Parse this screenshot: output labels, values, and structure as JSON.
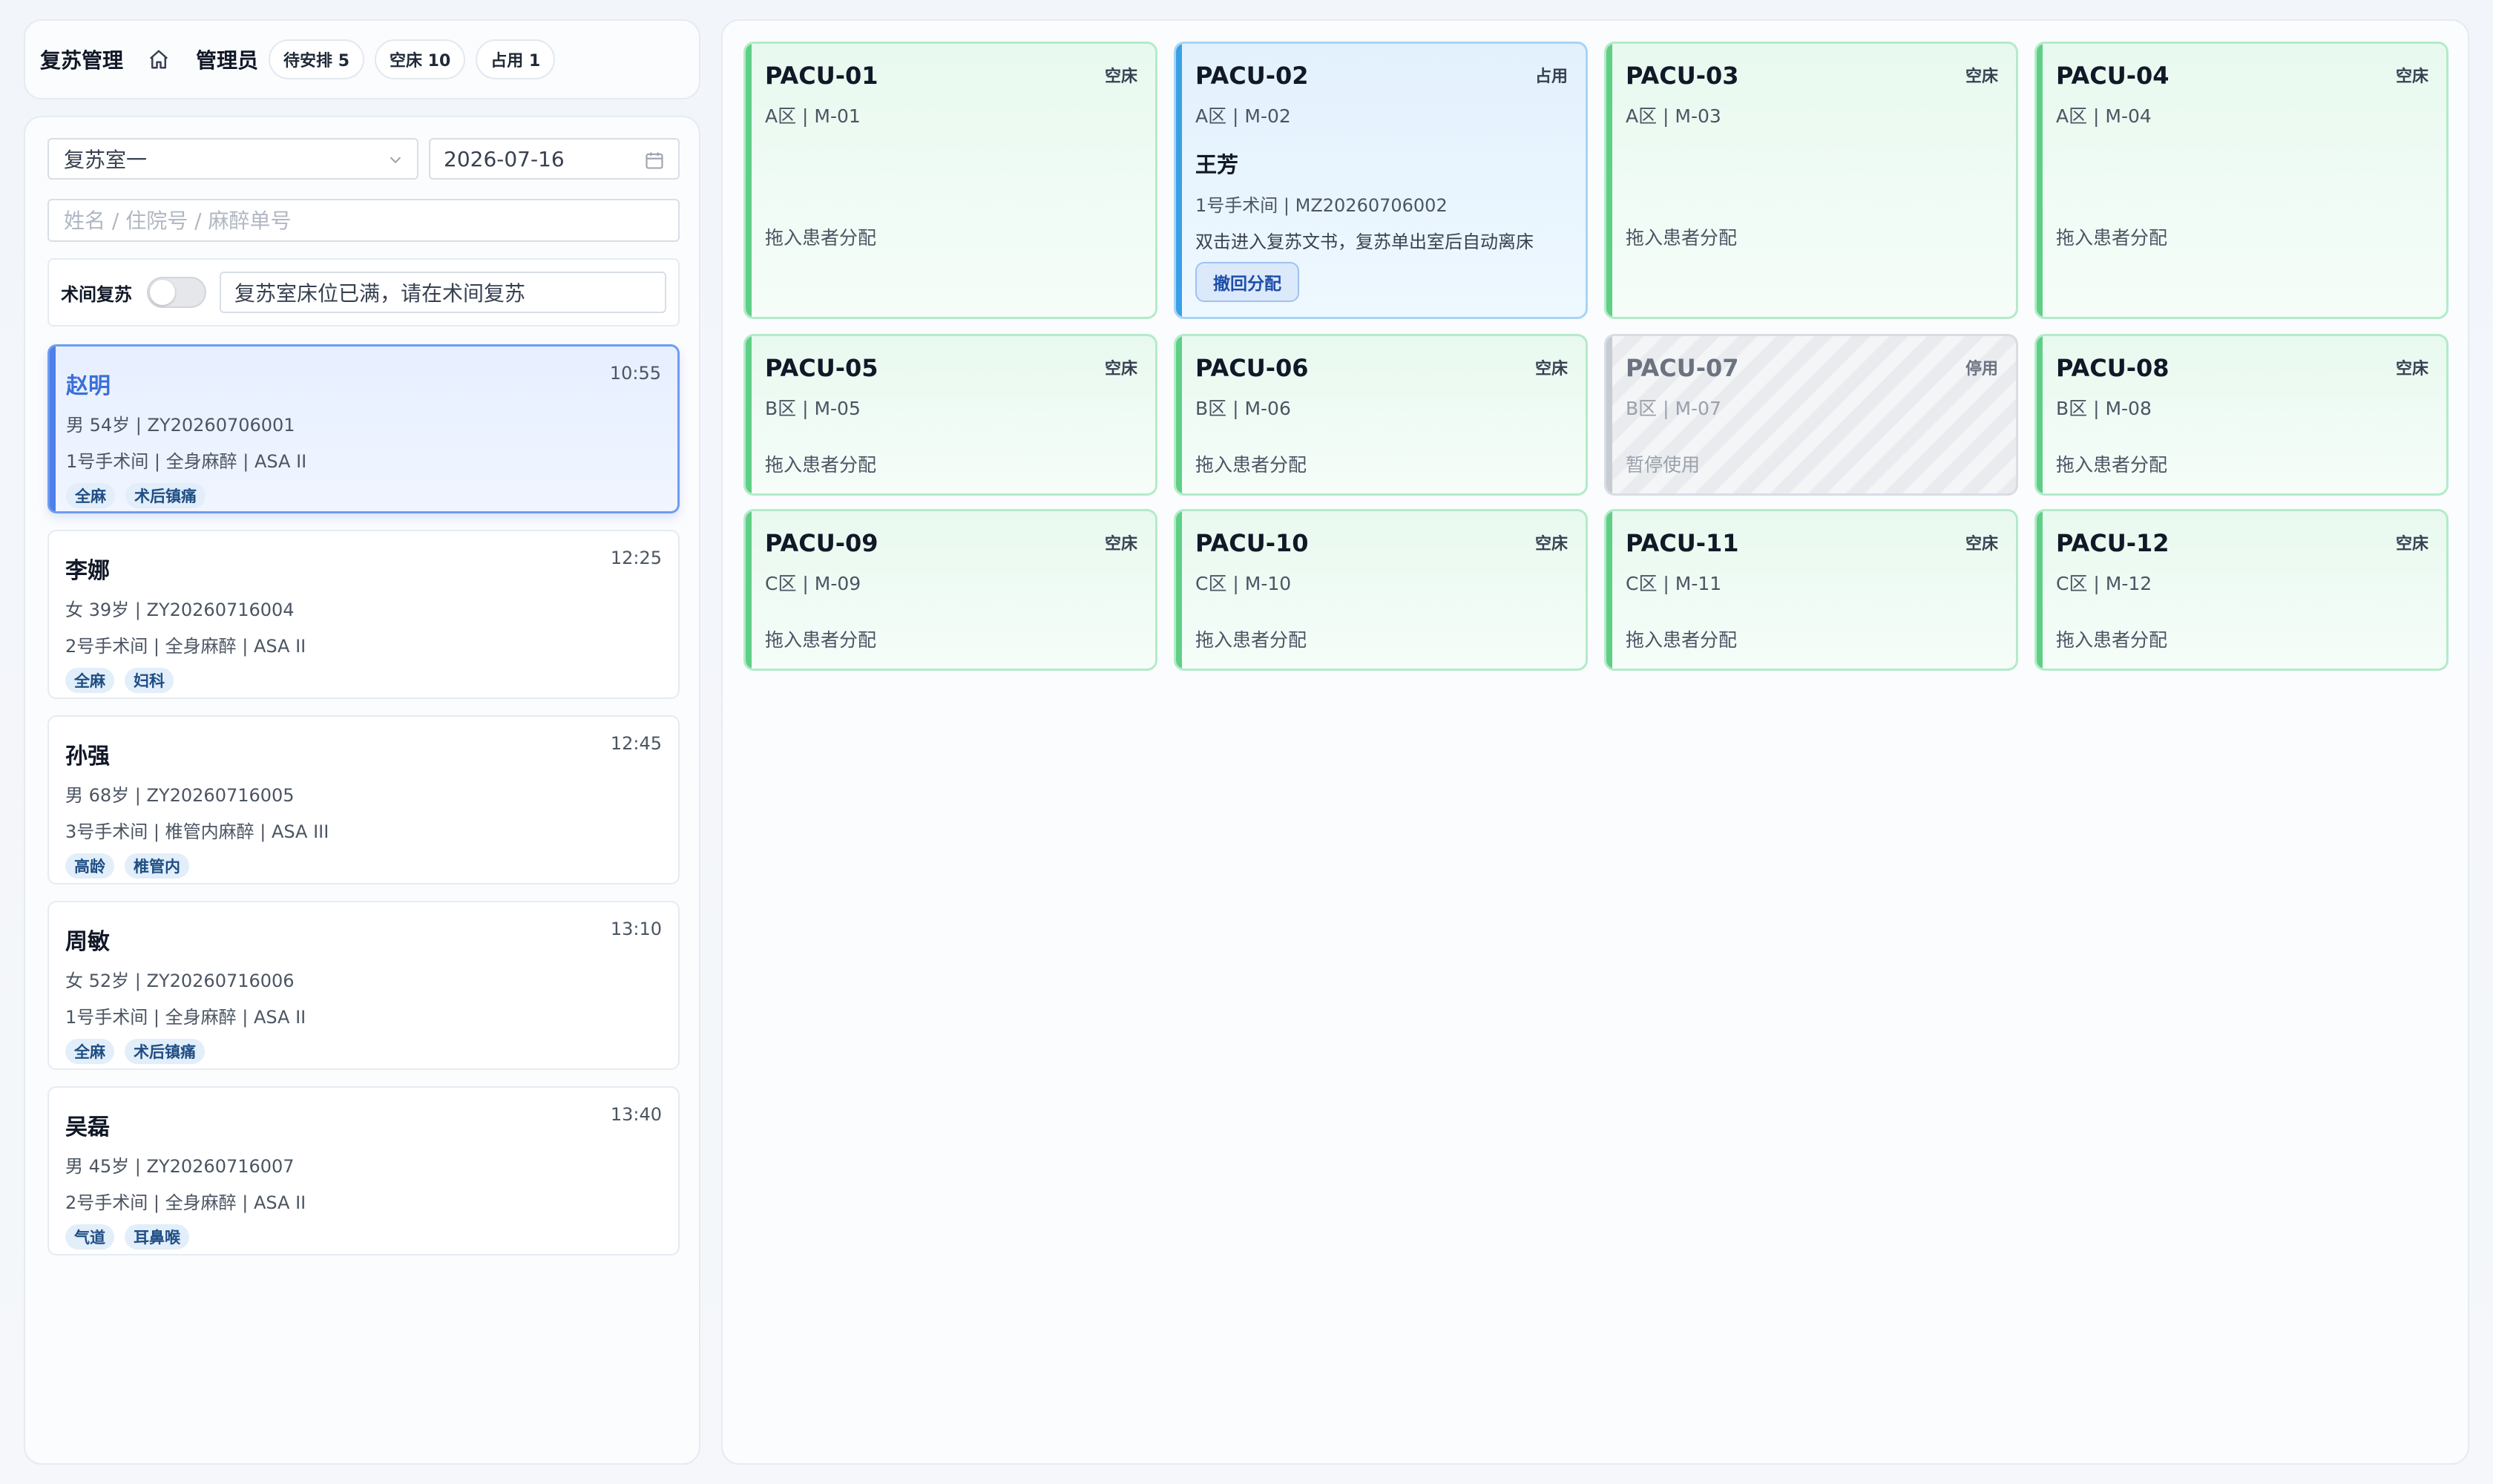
{
  "header": {
    "app_title": "复苏管理",
    "user_name": "管理员",
    "chips": [
      {
        "label": "待安排 5"
      },
      {
        "label": "空床 10"
      },
      {
        "label": "占用 1"
      }
    ]
  },
  "filters": {
    "room_select": "复苏室一",
    "date": "2026-07-16",
    "search_placeholder": "姓名 / 住院号 / 麻醉单号",
    "intraop_label": "术间复苏",
    "intraop_enabled": false,
    "notice": "复苏室床位已满，请在术间复苏"
  },
  "patients": [
    {
      "name": "赵明",
      "time": "10:55",
      "info": "男 54岁 | ZY20260706001",
      "surgery": "1号手术间 | 全身麻醉 | ASA II",
      "tags": [
        "全麻",
        "术后镇痛"
      ],
      "selected": true
    },
    {
      "name": "李娜",
      "time": "12:25",
      "info": "女 39岁 | ZY20260716004",
      "surgery": "2号手术间 | 全身麻醉 | ASA II",
      "tags": [
        "全麻",
        "妇科"
      ]
    },
    {
      "name": "孙强",
      "time": "12:45",
      "info": "男 68岁 | ZY20260716005",
      "surgery": "3号手术间 | 椎管内麻醉 | ASA III",
      "tags": [
        "高龄",
        "椎管内"
      ]
    },
    {
      "name": "周敏",
      "time": "13:10",
      "info": "女 52岁 | ZY20260716006",
      "surgery": "1号手术间 | 全身麻醉 | ASA II",
      "tags": [
        "全麻",
        "术后镇痛"
      ]
    },
    {
      "name": "吴磊",
      "time": "13:40",
      "info": "男 45岁 | ZY20260716007",
      "surgery": "2号手术间 | 全身麻醉 | ASA II",
      "tags": [
        "气道",
        "耳鼻喉"
      ]
    }
  ],
  "beds": [
    {
      "code": "PACU-01",
      "status": "空床",
      "loc": "A区 | M-01",
      "hint": "拖入患者分配"
    },
    {
      "code": "PACU-02",
      "status": "占用",
      "loc": "A区 | M-02",
      "patient": "王芳",
      "patient_info": "1号手术间 | MZ20260706002",
      "note": "双击进入复苏文书，复苏单出室后自动离床",
      "action": "撤回分配"
    },
    {
      "code": "PACU-03",
      "status": "空床",
      "loc": "A区 | M-03",
      "hint": "拖入患者分配"
    },
    {
      "code": "PACU-04",
      "status": "空床",
      "loc": "A区 | M-04",
      "hint": "拖入患者分配"
    },
    {
      "code": "PACU-05",
      "status": "空床",
      "loc": "B区 | M-05",
      "hint": "拖入患者分配"
    },
    {
      "code": "PACU-06",
      "status": "空床",
      "loc": "B区 | M-06",
      "hint": "拖入患者分配"
    },
    {
      "code": "PACU-07",
      "status": "停用",
      "loc": "B区 | M-07",
      "hint": "暂停使用"
    },
    {
      "code": "PACU-08",
      "status": "空床",
      "loc": "B区 | M-08",
      "hint": "拖入患者分配"
    },
    {
      "code": "PACU-09",
      "status": "空床",
      "loc": "C区 | M-09",
      "hint": "拖入患者分配"
    },
    {
      "code": "PACU-10",
      "status": "空床",
      "loc": "C区 | M-10",
      "hint": "拖入患者分配"
    },
    {
      "code": "PACU-11",
      "status": "空床",
      "loc": "C区 | M-11",
      "hint": "拖入患者分配"
    },
    {
      "code": "PACU-12",
      "status": "空床",
      "loc": "C区 | M-12",
      "hint": "拖入患者分配"
    }
  ],
  "icons": {
    "home": "home-icon",
    "dropdown": "chevron-down-icon",
    "calendar": "calendar-icon"
  }
}
